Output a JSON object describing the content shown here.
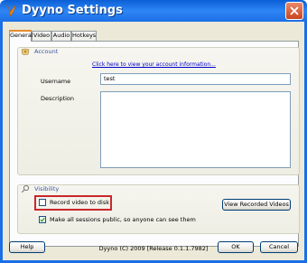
{
  "window": {
    "title": "Dyyno Settings",
    "close_label": "close"
  },
  "tabs": [
    {
      "label": "General",
      "active": true
    },
    {
      "label": "Video",
      "active": false
    },
    {
      "label": "Audio",
      "active": false
    },
    {
      "label": "Hotkeys",
      "active": false
    }
  ],
  "account": {
    "group_title": "Account",
    "view_info_link": "Click here to view your account information...",
    "username_label": "Username",
    "username_value": "test",
    "description_label": "Description",
    "description_value": ""
  },
  "visibility": {
    "group_title": "Visibility",
    "record_label": "Record video to disk",
    "record_checked": false,
    "public_label": "Make all sessions public, so anyone can see them",
    "public_checked": true,
    "view_recorded_button": "View Recorded Videos"
  },
  "footer": {
    "help_button": "Help",
    "status_text": "Dyyno (C) 2009 [Release 0.1.1.7982]",
    "ok_button": "OK",
    "cancel_button": "Cancel"
  },
  "colors": {
    "titlebar": "#1b6fe6",
    "group_title": "#3c55a5",
    "highlight": "#c8282a",
    "link": "#0000cc"
  }
}
